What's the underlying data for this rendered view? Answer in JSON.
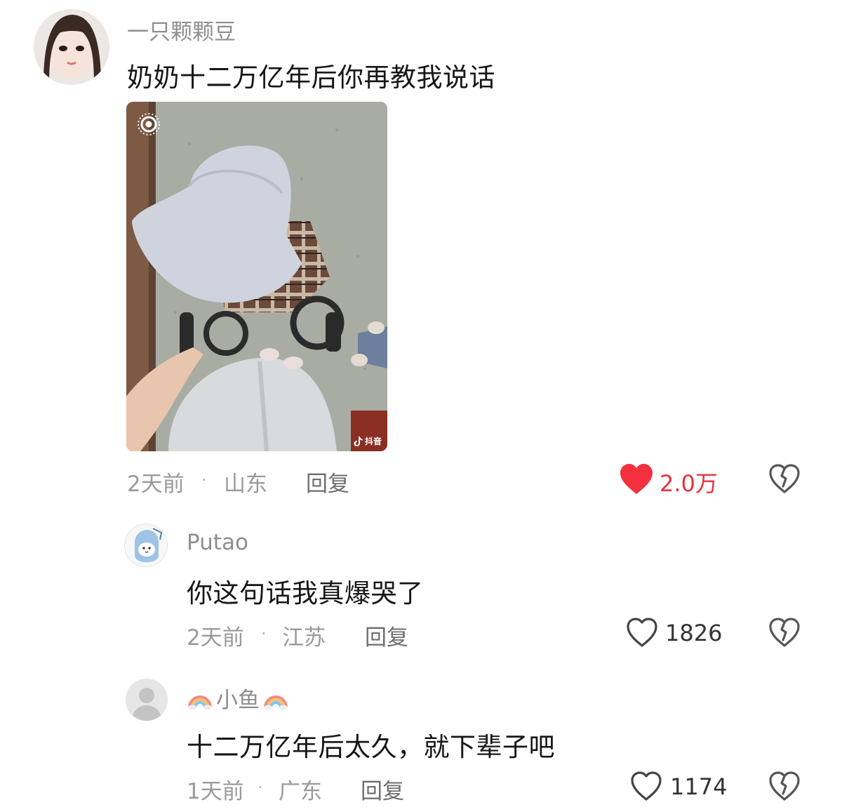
{
  "comments": [
    {
      "username": "一只颗颗豆",
      "text": "奶奶十二万亿年后你再教我说话",
      "time": "2天前",
      "separator": "·",
      "location": "山东",
      "reply_label": "回复",
      "likes": "2.0万",
      "liked": true,
      "image": {
        "watermark": "抖音"
      }
    },
    {
      "username": "Putao",
      "text": "你这句话我真爆哭了",
      "time": "2天前",
      "separator": "·",
      "location": "江苏",
      "reply_label": "回复",
      "likes": "1826",
      "liked": false
    },
    {
      "username": "小鱼",
      "username_emoji": "🌈",
      "text": "十二万亿年后太久，就下辈子吧",
      "time": "1天前",
      "separator": "·",
      "location": "广东",
      "reply_label": "回复",
      "likes": "1174",
      "liked": false
    }
  ],
  "colors": {
    "liked_heart": "#f2303e",
    "text_primary": "#161616",
    "text_secondary": "#9a9a9a"
  },
  "icons": {
    "like": "heart-icon",
    "dislike": "broken-heart-icon",
    "live_photo": "live-photo-icon"
  }
}
